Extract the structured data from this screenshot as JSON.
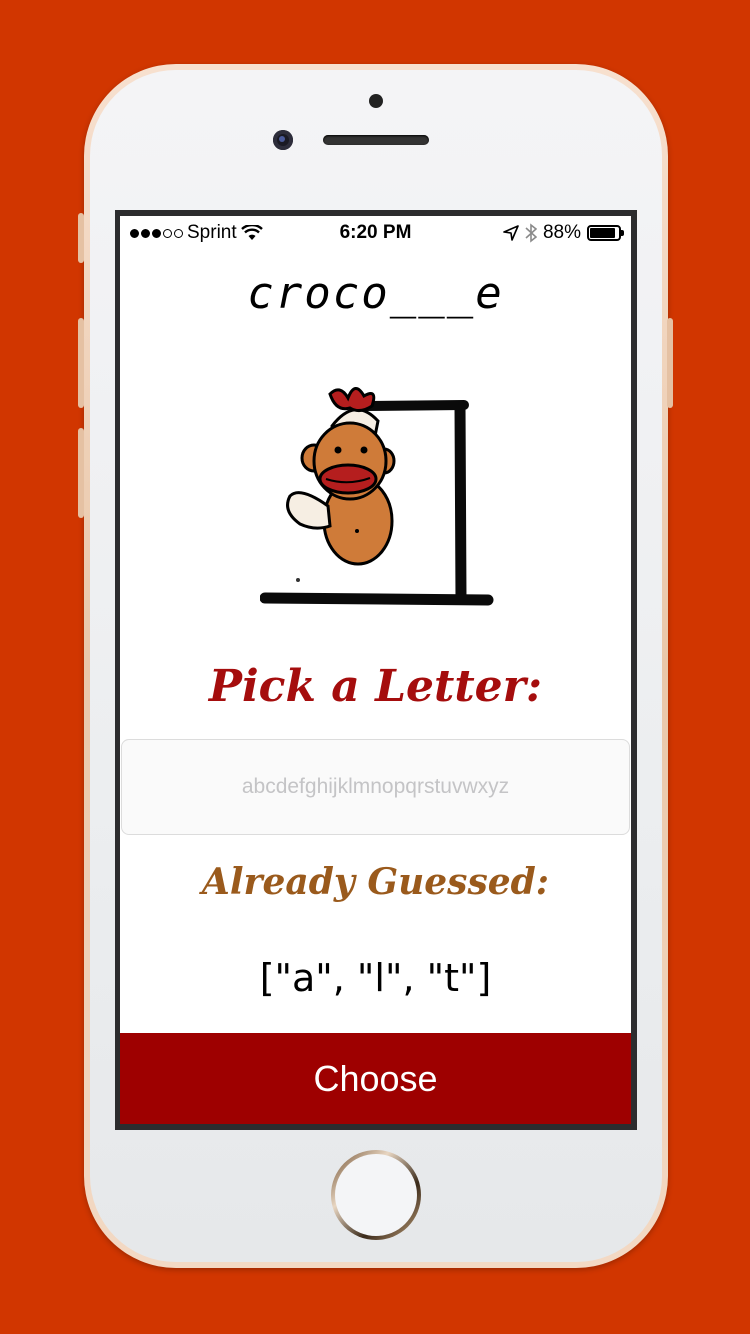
{
  "colors": {
    "background": "#d13600",
    "title_red": "#a50d0d",
    "guessed_brown": "#9a5a1c",
    "button_red": "#9e0000"
  },
  "status_bar": {
    "carrier": "Sprint",
    "time": "6:20 PM",
    "battery": "88%",
    "battery_level": 0.88,
    "signal_bars_filled": 3,
    "signal_bars_total": 5,
    "icons": [
      "wifi-icon",
      "location-arrow-icon",
      "bluetooth-icon",
      "battery-icon"
    ]
  },
  "game": {
    "word_display": "croco___e",
    "pick_label": "Pick a Letter:",
    "input_placeholder": "abcdefghijklmnopqrstuvwxyz",
    "input_value": "",
    "already_label": "Already Guessed:",
    "guessed_letters": "[\"a\", \"l\", \"t\"]",
    "choose_button": "Choose",
    "illustration": "sock-monkey-hangman"
  }
}
